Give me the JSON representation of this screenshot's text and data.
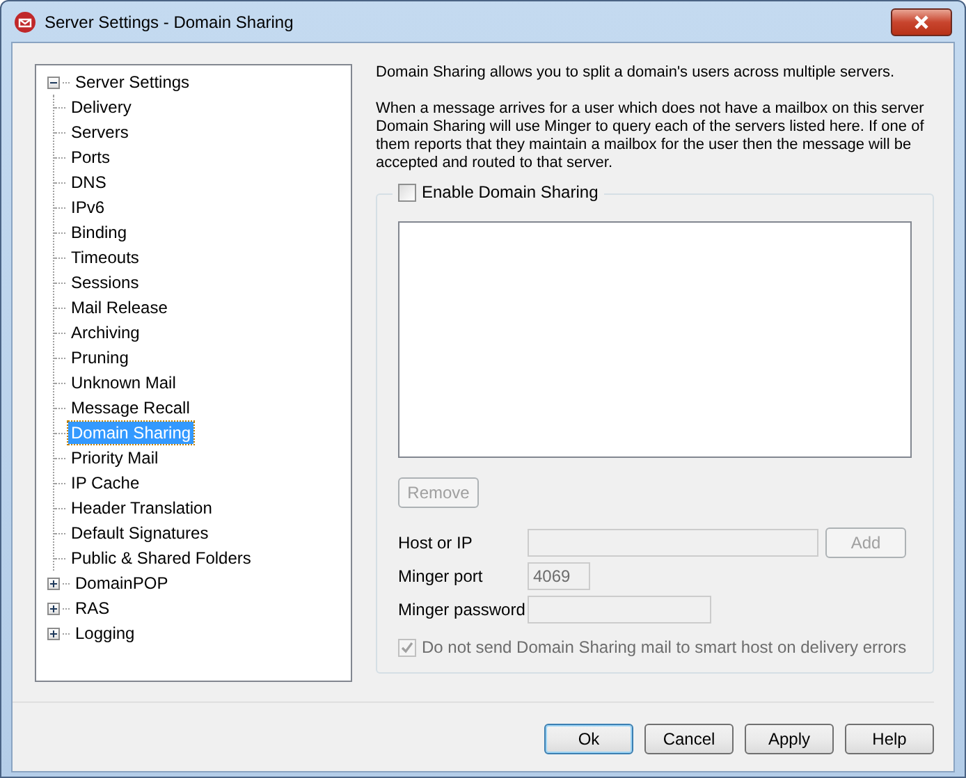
{
  "window": {
    "title": "Server Settings - Domain Sharing"
  },
  "tree": [
    {
      "label": "Server Settings",
      "expanded": true,
      "selected": false,
      "children": [
        {
          "label": "Delivery",
          "selected": false
        },
        {
          "label": "Servers",
          "selected": false
        },
        {
          "label": "Ports",
          "selected": false
        },
        {
          "label": "DNS",
          "selected": false
        },
        {
          "label": "IPv6",
          "selected": false
        },
        {
          "label": "Binding",
          "selected": false
        },
        {
          "label": "Timeouts",
          "selected": false
        },
        {
          "label": "Sessions",
          "selected": false
        },
        {
          "label": "Mail Release",
          "selected": false
        },
        {
          "label": "Archiving",
          "selected": false
        },
        {
          "label": "Pruning",
          "selected": false
        },
        {
          "label": "Unknown Mail",
          "selected": false
        },
        {
          "label": "Message Recall",
          "selected": false
        },
        {
          "label": "Domain Sharing",
          "selected": true
        },
        {
          "label": "Priority Mail",
          "selected": false
        },
        {
          "label": "IP Cache",
          "selected": false
        },
        {
          "label": "Header Translation",
          "selected": false
        },
        {
          "label": "Default Signatures",
          "selected": false
        },
        {
          "label": "Public & Shared Folders",
          "selected": false
        }
      ]
    },
    {
      "label": "DomainPOP",
      "expanded": false,
      "selected": false
    },
    {
      "label": "RAS",
      "expanded": false,
      "selected": false
    },
    {
      "label": "Logging",
      "expanded": false,
      "selected": false
    }
  ],
  "description": [
    "Domain Sharing allows you to split a domain's users across multiple servers.",
    "When a message arrives for a user which does not have a mailbox on this server Domain Sharing will use Minger to query each of the servers listed here.  If one of them reports that they maintain a mailbox for the user then the message will be accepted and routed to that server."
  ],
  "enable_checkbox": {
    "label": "Enable Domain Sharing",
    "checked": false
  },
  "remove_button": {
    "label": "Remove",
    "disabled": true
  },
  "fields": [
    {
      "label": "Host or IP",
      "disabled": true,
      "button": {
        "label": "Add",
        "disabled": true
      }
    },
    {
      "label": "Minger port",
      "value": "4069",
      "disabled": true
    },
    {
      "label": "Minger password",
      "disabled": true
    }
  ],
  "smart_host_checkbox": {
    "label": "Do not send Domain Sharing mail to smart host on delivery errors",
    "checked": true,
    "disabled": true
  },
  "buttons": [
    {
      "label": "Ok",
      "default": true
    },
    {
      "label": "Cancel",
      "default": false
    },
    {
      "label": "Apply",
      "default": false
    },
    {
      "label": "Help",
      "default": false
    }
  ]
}
